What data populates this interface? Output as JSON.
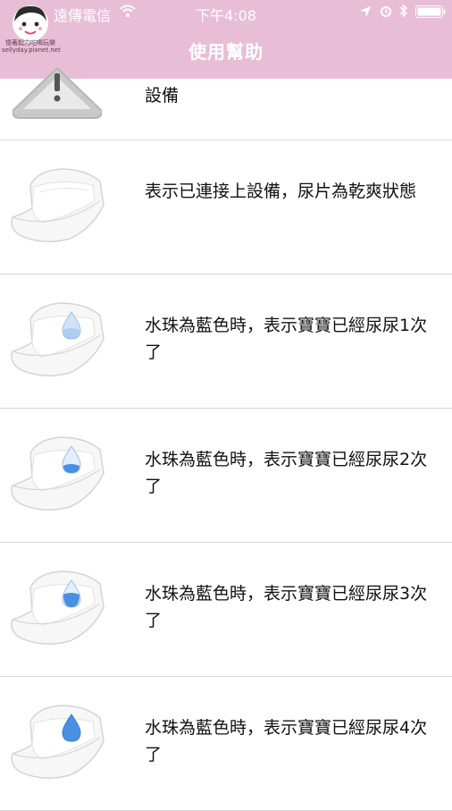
{
  "status_bar": {
    "carrier": "遠傳電信",
    "time": "下午4:08"
  },
  "header": {
    "title": "使用幫助",
    "logo_caption": "憶著起力吃喝玩樂",
    "logo_url_text": "sellyday.pixnet.net",
    "background_color": "#e8bed6"
  },
  "help_items": [
    {
      "text": "設備",
      "icon": "warning-icon"
    },
    {
      "text": "表示已連接上設備，尿片為乾爽狀態",
      "icon": "dry-diaper-icon"
    },
    {
      "text": "水珠為藍色時，表示寶寶已經尿尿1次了",
      "icon": "diaper-drop-1-icon"
    },
    {
      "text": "水珠為藍色時，表示寶寶已經尿尿2次了",
      "icon": "diaper-drop-2-icon"
    },
    {
      "text": "水珠為藍色時，表示寶寶已經尿尿3次了",
      "icon": "diaper-drop-3-icon"
    },
    {
      "text": "水珠為藍色時，表示寶寶已經尿尿4次了",
      "icon": "diaper-drop-4-icon"
    }
  ],
  "colors": {
    "drop_blue": "#4a90e2",
    "divider": "#d6d6d6"
  }
}
